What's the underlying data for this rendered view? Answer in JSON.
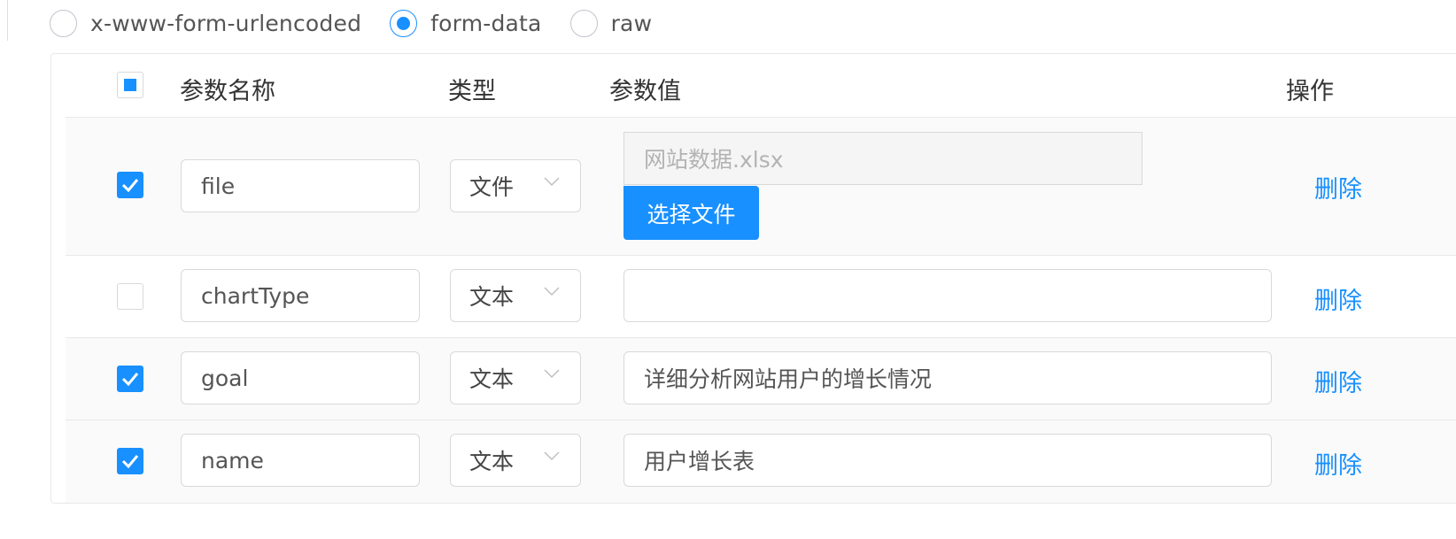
{
  "body_type": {
    "options": [
      {
        "label": "x-www-form-urlencoded",
        "checked": false
      },
      {
        "label": "form-data",
        "checked": true
      },
      {
        "label": "raw",
        "checked": false
      }
    ]
  },
  "table": {
    "columns": {
      "name": "参数名称",
      "type": "类型",
      "value": "参数值",
      "action": "操作"
    },
    "select_all_state": "indeterminate",
    "rows": [
      {
        "checked": true,
        "name": "file",
        "type": "文件",
        "value": "网站数据.xlsx",
        "file_button": "选择文件",
        "action": "删除"
      },
      {
        "checked": false,
        "name": "chartType",
        "type": "文本",
        "value": "",
        "action": "删除"
      },
      {
        "checked": true,
        "name": "goal",
        "type": "文本",
        "value": "详细分析网站用户的增长情况",
        "action": "删除"
      },
      {
        "checked": true,
        "name": "name",
        "type": "文本",
        "value": "用户增长表",
        "action": "删除"
      }
    ]
  },
  "colors": {
    "accent": "#1890ff",
    "border": "#e8e8e8",
    "row_alt": "#fafafa"
  }
}
